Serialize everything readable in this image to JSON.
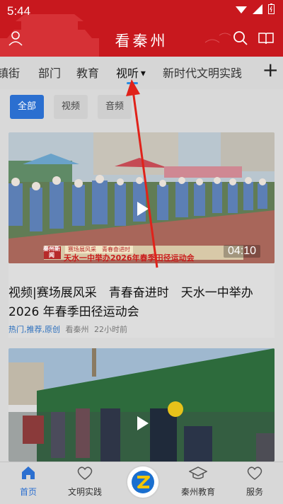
{
  "status": {
    "time": "5:44"
  },
  "header": {
    "title": "看秦州"
  },
  "tabs": [
    {
      "label": "镇街"
    },
    {
      "label": "部门"
    },
    {
      "label": "教育"
    },
    {
      "label": "视听",
      "active": true
    },
    {
      "label": "新时代文明实践"
    }
  ],
  "filters": [
    {
      "label": "全部",
      "active": true
    },
    {
      "label": "视频"
    },
    {
      "label": "音频"
    }
  ],
  "cards": [
    {
      "banner_program": "秦州新闻",
      "banner_small": "赛场展风采　青春奋进时",
      "banner_main": "天水一中举办2026年春季田径运动会",
      "duration": "04:10",
      "title": "视频|赛场展风采　青春奋进时　天水一中举办 2026 年春季田径运动会",
      "tags": "热门,推荐,原创",
      "source": "看秦州",
      "time": "22小时前"
    },
    {
      "title": ""
    }
  ],
  "bottom_nav": [
    {
      "label": "首页",
      "icon": "home-icon",
      "active": true
    },
    {
      "label": "文明实践",
      "icon": "heart-icon"
    },
    {
      "label": "",
      "icon": "center-logo-icon"
    },
    {
      "label": "秦州教育",
      "icon": "graduation-cap-icon"
    },
    {
      "label": "服务",
      "icon": "heart-icon"
    }
  ],
  "colors": {
    "brand_red": "#c8181e",
    "accent_blue": "#2b6fd0",
    "arrow_red": "#e0221a"
  }
}
